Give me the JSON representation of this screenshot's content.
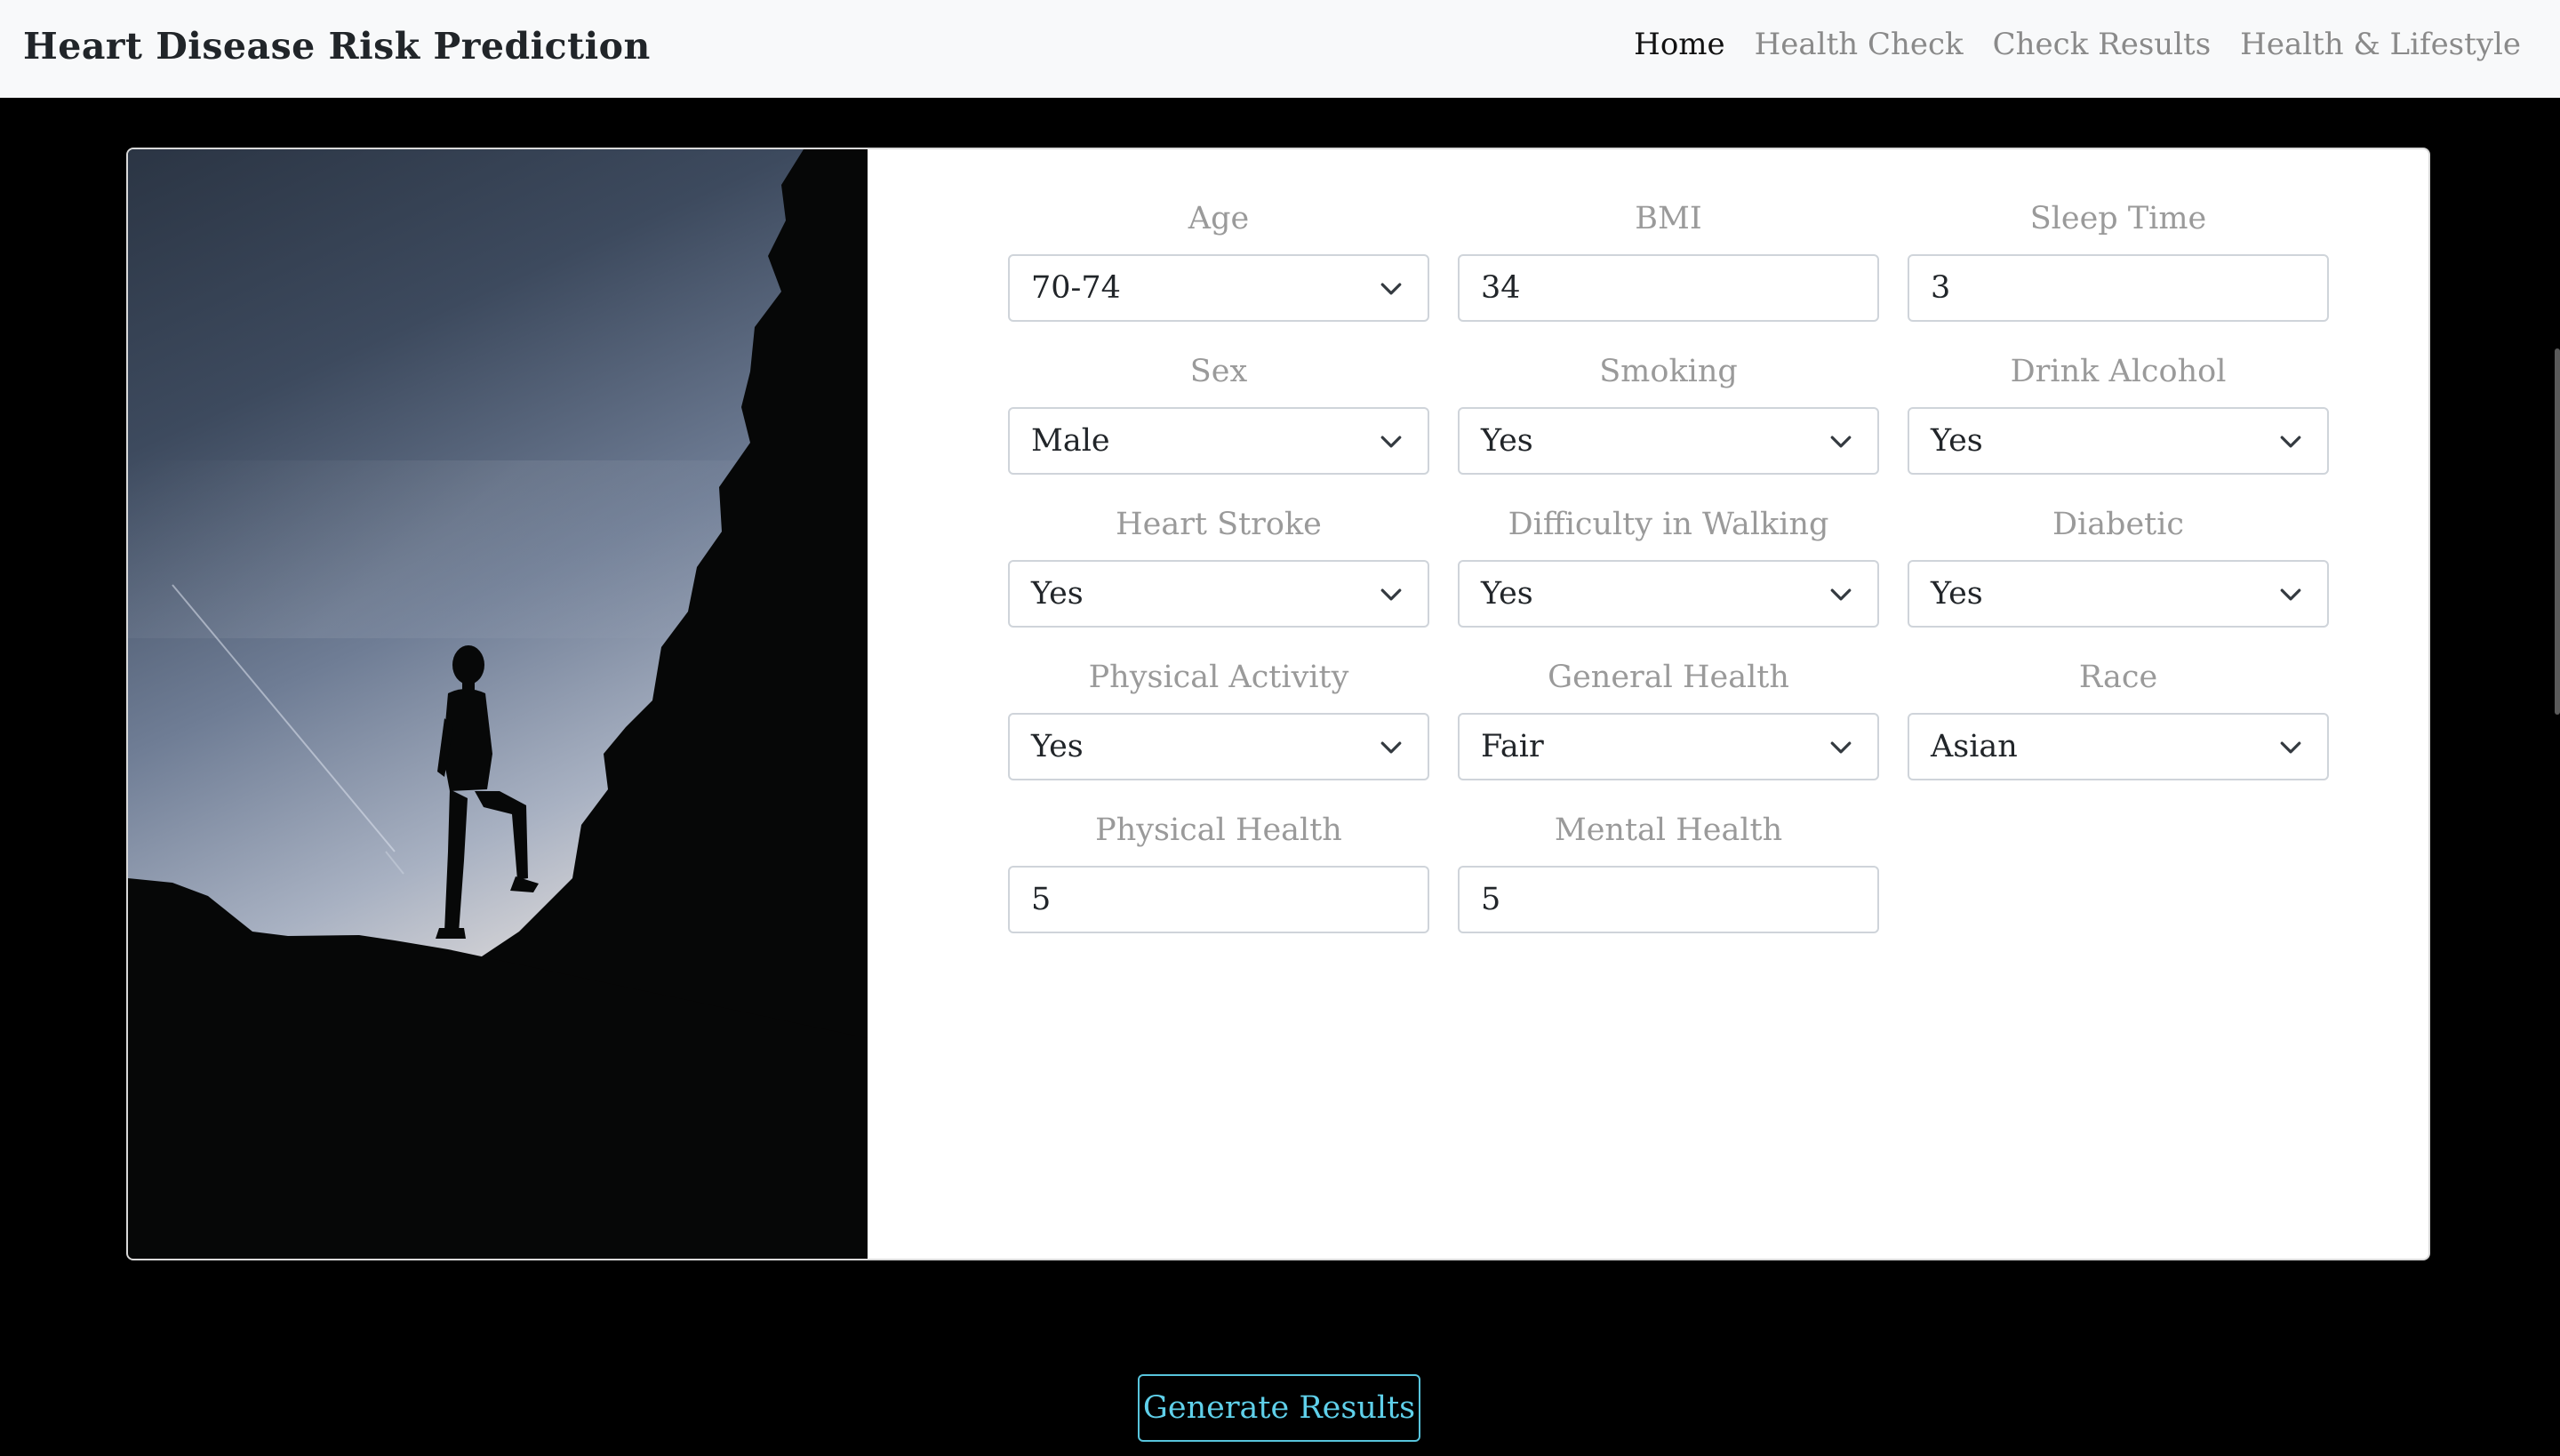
{
  "navbar": {
    "brand": "Heart Disease Risk Prediction",
    "links": [
      {
        "label": "Home",
        "active": true
      },
      {
        "label": "Health Check",
        "active": false
      },
      {
        "label": "Check Results",
        "active": false
      },
      {
        "label": "Health & Lifestyle",
        "active": false
      }
    ]
  },
  "form": {
    "age": {
      "label": "Age",
      "value": "70-74",
      "type": "select"
    },
    "bmi": {
      "label": "BMI",
      "value": "34",
      "type": "input"
    },
    "sleep_time": {
      "label": "Sleep Time",
      "value": "3",
      "type": "input"
    },
    "sex": {
      "label": "Sex",
      "value": "Male",
      "type": "select"
    },
    "smoking": {
      "label": "Smoking",
      "value": "Yes",
      "type": "select"
    },
    "drink_alcohol": {
      "label": "Drink Alcohol",
      "value": "Yes",
      "type": "select"
    },
    "heart_stroke": {
      "label": "Heart Stroke",
      "value": "Yes",
      "type": "select"
    },
    "difficulty_walking": {
      "label": "Difficulty in Walking",
      "value": "Yes",
      "type": "select"
    },
    "diabetic": {
      "label": "Diabetic",
      "value": "Yes",
      "type": "select"
    },
    "physical_activity": {
      "label": "Physical Activity",
      "value": "Yes",
      "type": "select"
    },
    "general_health": {
      "label": "General Health",
      "value": "Fair",
      "type": "select"
    },
    "race": {
      "label": "Race",
      "value": "Asian",
      "type": "select"
    },
    "physical_health": {
      "label": "Physical Health",
      "value": "5",
      "type": "input"
    },
    "mental_health": {
      "label": "Mental Health",
      "value": "5",
      "type": "input"
    }
  },
  "generate_button": "Generate Results",
  "icons": {
    "select_arrow": "chevron-down-icon"
  },
  "colors": {
    "page_background": "#000000",
    "navbar_background": "#f8f9fa",
    "label_gray": "#9a9a9a",
    "button_accent": "#5fd0ea"
  }
}
